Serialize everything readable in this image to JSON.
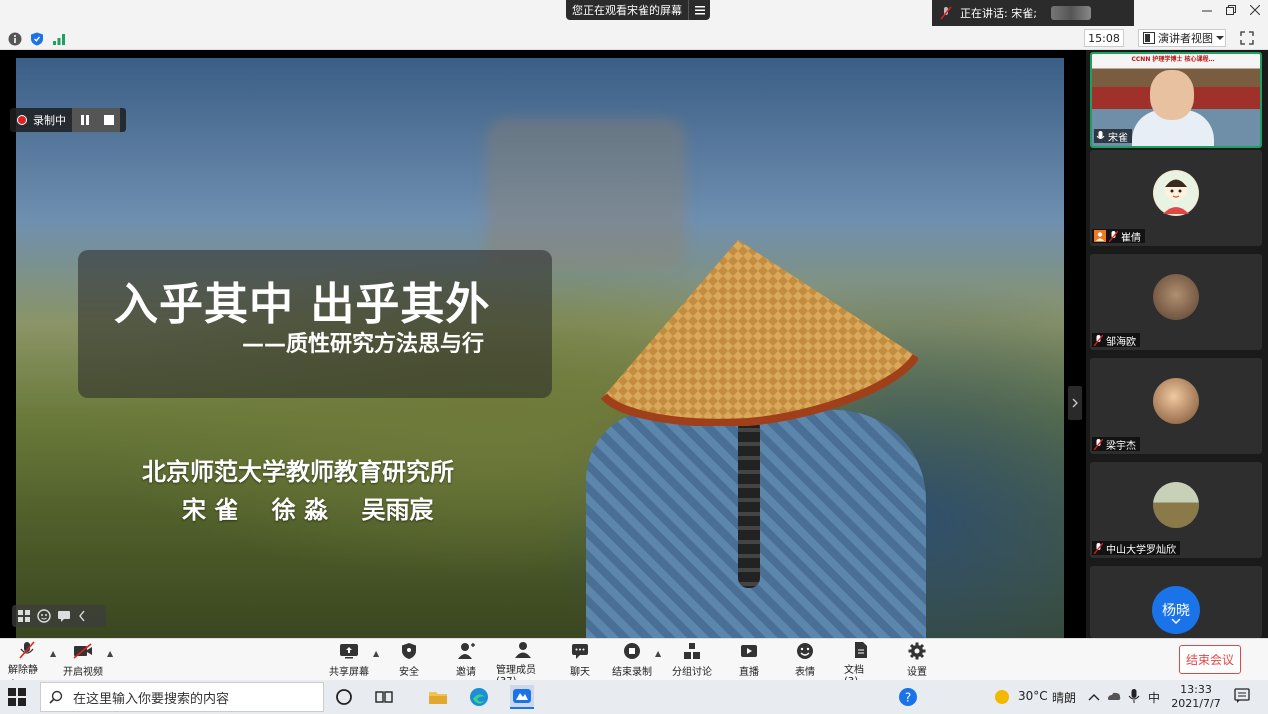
{
  "screen_share_banner": {
    "text": "您正在观看宋雀的屏幕"
  },
  "speaking_indicator": {
    "label": "正在讲话: 宋雀;"
  },
  "meeting_toolbar": {
    "time": "15:08",
    "view_label": "演讲者视图"
  },
  "recording": {
    "label": "录制中"
  },
  "slide": {
    "title": "入乎其中 出乎其外",
    "subtitle": "——质性研究方法思与行",
    "institution": "北京师范大学教师教育研究所",
    "authors": "宋 雀    徐 淼    吴雨宸"
  },
  "participants": [
    {
      "name": "宋雀",
      "banner": "CCNN 护理学博士 核心课程…"
    },
    {
      "name": "崔倩"
    },
    {
      "name": "邹海欧"
    },
    {
      "name": "梁宇杰"
    },
    {
      "name": "中山大学罗灿欣"
    },
    {
      "name": "杨晓",
      "avatar_text": "杨晓"
    }
  ],
  "bottom_toolbar": {
    "unmute": "解除静音",
    "start_video": "开启视频",
    "share_screen": "共享屏幕",
    "security": "安全",
    "invite": "邀请",
    "participants": "管理成员(37)",
    "chat": "聊天",
    "stop_recording": "结束录制",
    "breakout": "分组讨论",
    "live": "直播",
    "reactions": "表情",
    "docs": "文档(3)",
    "settings": "设置",
    "end_meeting": "结束会议"
  },
  "taskbar": {
    "search_placeholder": "在这里输入你要搜索的内容",
    "temperature": "30°C",
    "weather": "晴朗",
    "ime": "中",
    "time": "13:33",
    "date": "2021/7/7"
  },
  "colors": {
    "record_red": "#e02020",
    "end_meeting_red": "#e04848",
    "active_speaker_border": "#20a060",
    "avatar_blue": "#1a73e8"
  }
}
